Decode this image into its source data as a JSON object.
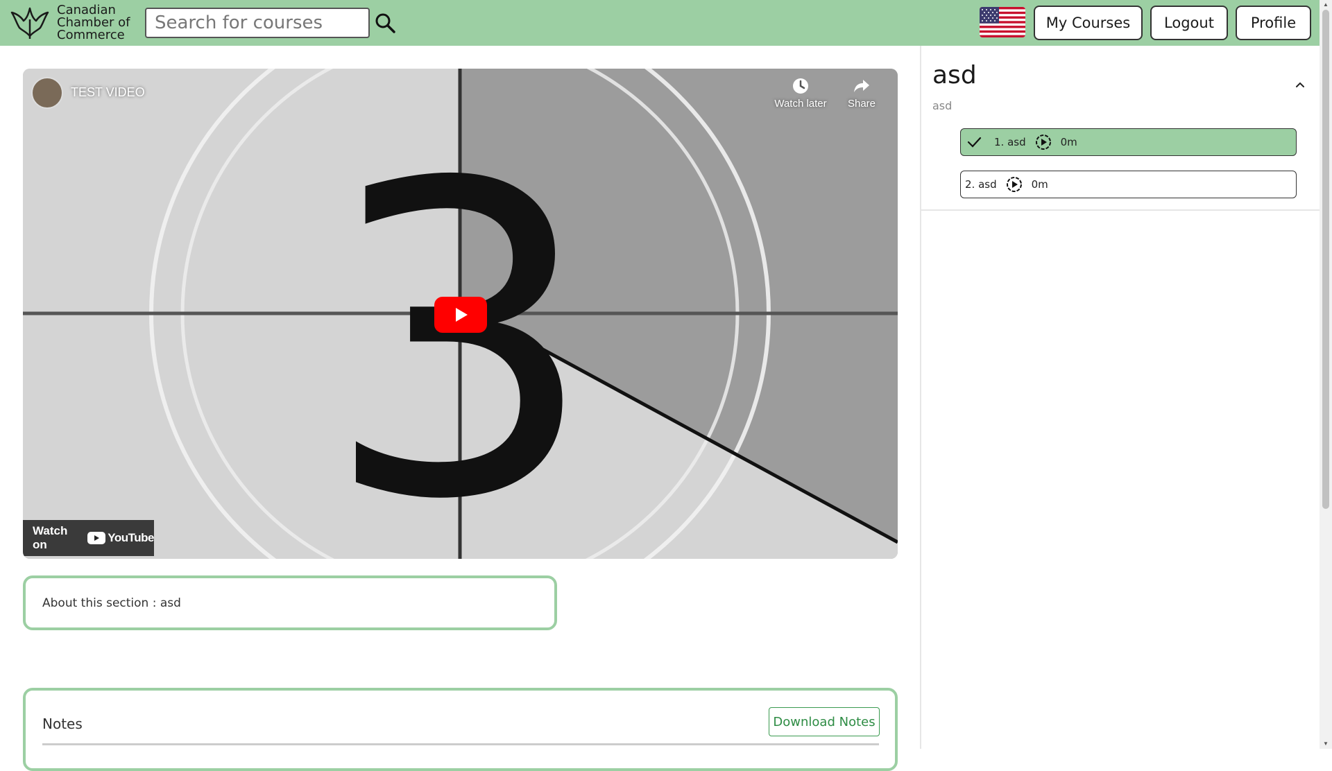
{
  "header": {
    "brand": [
      "Canadian",
      "Chamber of",
      "Commerce"
    ],
    "search_placeholder": "Search for courses",
    "buttons": {
      "my_courses": "My Courses",
      "logout": "Logout",
      "profile": "Profile"
    },
    "language_flag": "us-flag-icon",
    "bg_color": "#9ccfa3"
  },
  "video": {
    "title": "TEST VIDEO",
    "watch_later": "Watch later",
    "share": "Share",
    "watch_on": "Watch on",
    "youtube": "YouTube",
    "countdown_number": "3"
  },
  "about": {
    "text": "About this section : asd"
  },
  "notes": {
    "title": "Notes",
    "download_label": "Download Notes"
  },
  "sidebar": {
    "section_title": "asd",
    "section_subtitle": "asd",
    "lessons": [
      {
        "label": "1. asd",
        "duration": "0m",
        "completed": true
      },
      {
        "label": "2. asd",
        "duration": "0m",
        "completed": false
      }
    ]
  },
  "colors": {
    "accent": "#9ccfa3",
    "play_red": "#ff0000",
    "download_green": "#2e8c44"
  }
}
